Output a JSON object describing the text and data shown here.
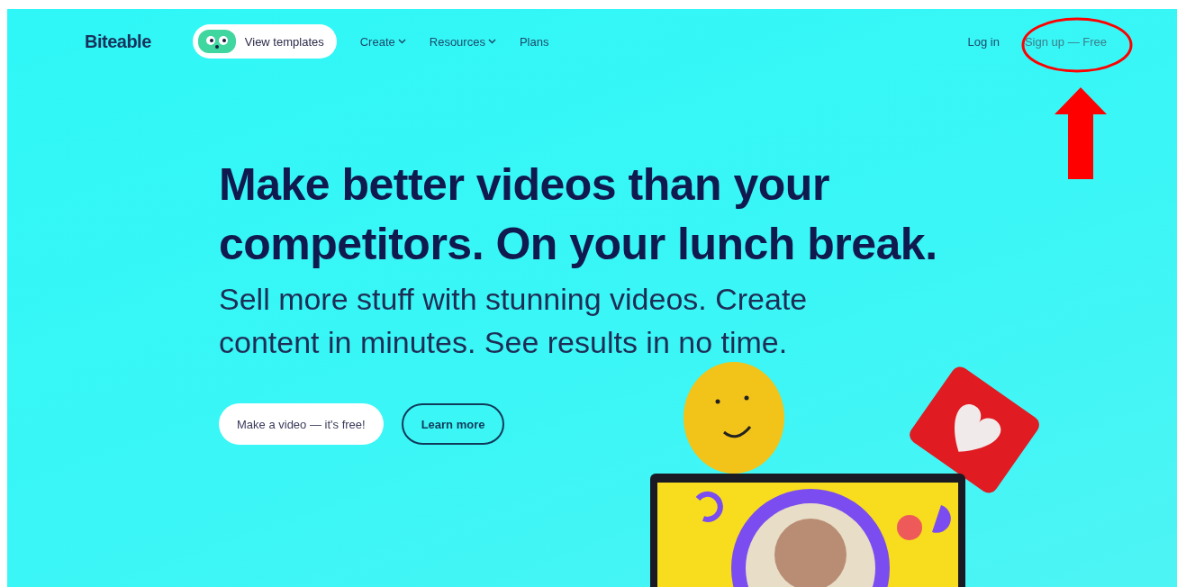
{
  "nav": {
    "logo": "Biteable",
    "templates_button": "View templates",
    "menu": [
      {
        "label": "Create",
        "kind": "dropdown"
      },
      {
        "label": "Resources",
        "kind": "dropdown"
      },
      {
        "label": "Plans",
        "kind": "link"
      }
    ],
    "login": "Log in",
    "signup": "Sign up — Free"
  },
  "hero": {
    "heading": "Make better videos than your competitors. On your lunch break.",
    "subheading": "Sell more stuff with stunning videos. Create content in minutes. See results in no time.",
    "buttons": [
      {
        "label": "Make a video — it's free!",
        "kind": "primary"
      },
      {
        "label": "Learn more",
        "kind": "outline"
      }
    ]
  }
}
